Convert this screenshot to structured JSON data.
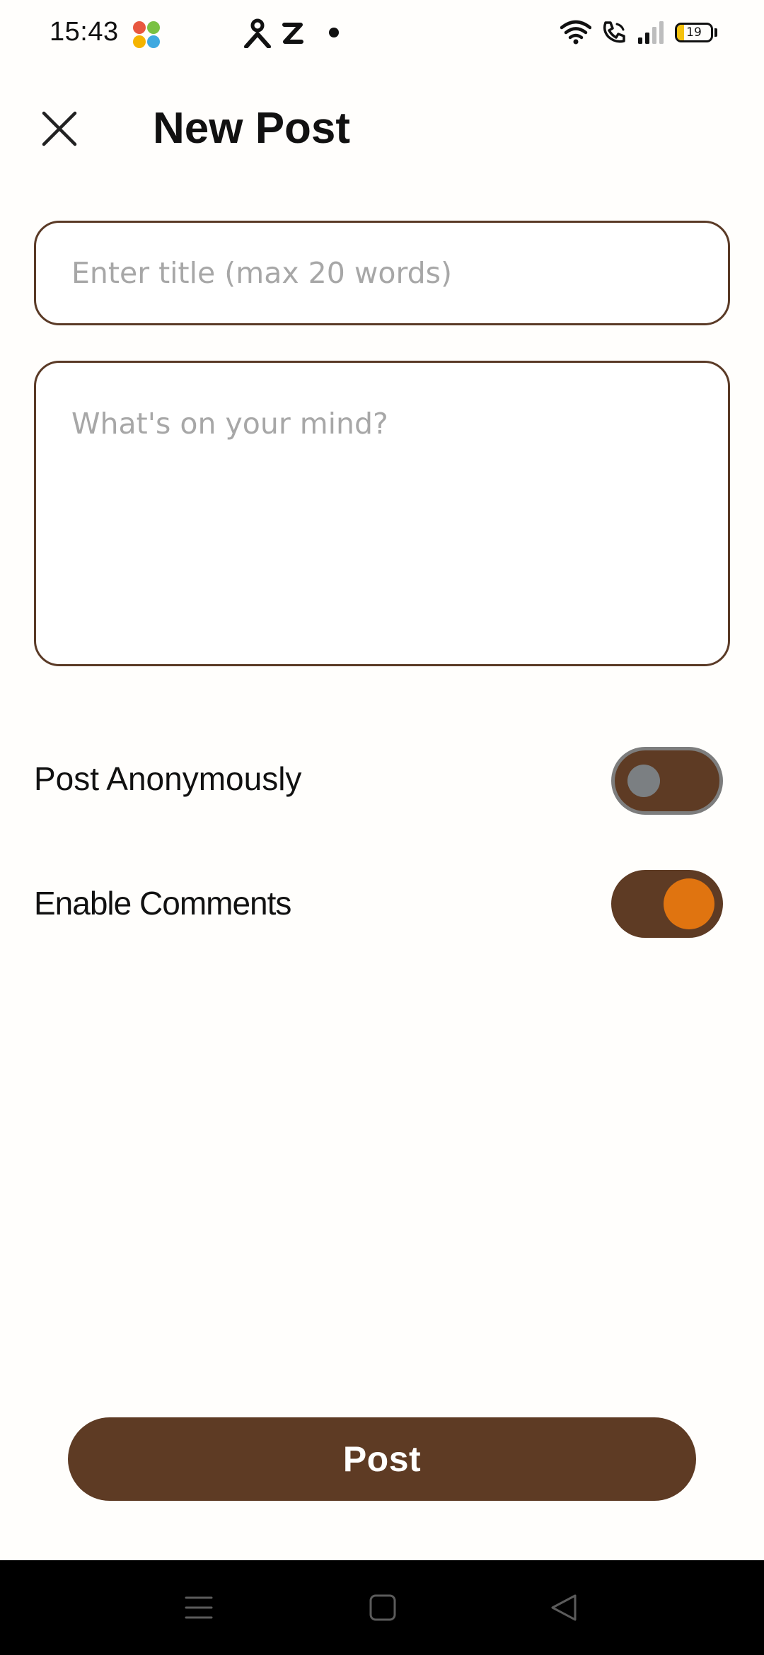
{
  "status_bar": {
    "time": "15:43",
    "battery_level": "19",
    "icons": [
      "app-launcher-icon",
      "person-icon",
      "z-icon",
      "dot-icon",
      "wifi-icon",
      "wifi-calling-icon",
      "signal-icon",
      "battery-icon"
    ]
  },
  "header": {
    "title": "New Post",
    "close_icon": "close-icon"
  },
  "form": {
    "title_placeholder": "Enter title (max 20 words)",
    "title_value": "",
    "body_placeholder": "What's on your mind?",
    "body_value": ""
  },
  "toggles": [
    {
      "label": "Post Anonymously",
      "on": false
    },
    {
      "label": "Enable Comments",
      "on": true
    }
  ],
  "post_button": {
    "label": "Post"
  },
  "nav_bar": {
    "icons": [
      "menu-icon",
      "home-icon",
      "back-icon"
    ]
  },
  "colors": {
    "brand_brown": "#5E3B24",
    "accent_orange": "#E07410",
    "border_brown": "#5A3A26",
    "placeholder_gray": "#A7A7A7",
    "background": "#FFFEFC"
  }
}
